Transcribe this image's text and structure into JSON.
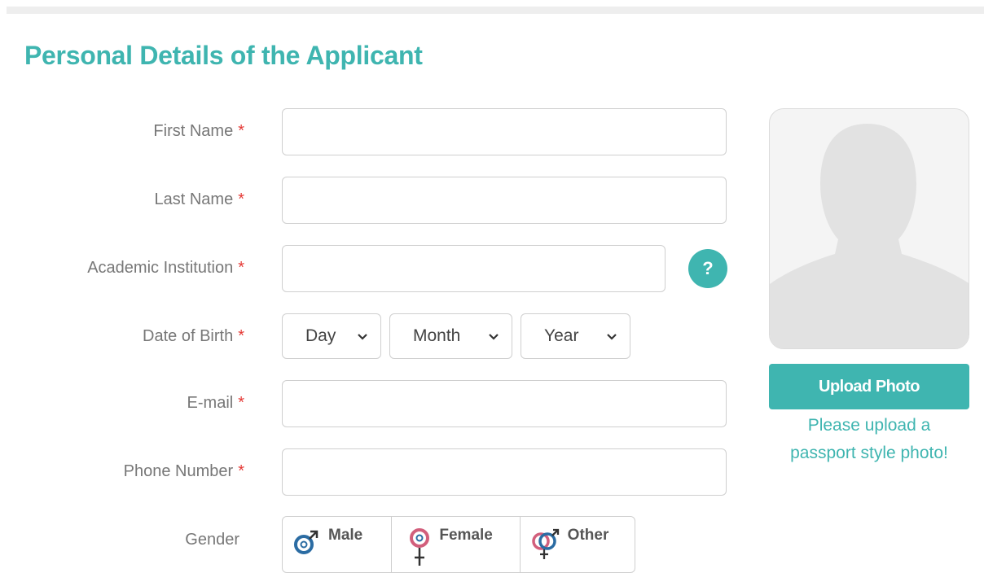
{
  "form": {
    "title": "Personal Details of the Applicant",
    "required_marker": "*",
    "fields": {
      "first_name": {
        "label": "First Name",
        "value": ""
      },
      "last_name": {
        "label": "Last Name",
        "value": ""
      },
      "institution": {
        "label": "Academic Institution",
        "value": "",
        "help": "?"
      },
      "dob": {
        "label": "Date of Birth",
        "day": "Day",
        "month": "Month",
        "year": "Year"
      },
      "email": {
        "label": "E-mail",
        "value": ""
      },
      "phone": {
        "label": "Phone Number",
        "value": ""
      },
      "gender": {
        "label": "Gender",
        "options": [
          "Male",
          "Female",
          "Other"
        ]
      }
    }
  },
  "photo": {
    "upload_label": "Upload Photo",
    "note_line1": "Please upload a",
    "note_line2": "passport style photo!"
  },
  "colors": {
    "accent": "#3fb5b0",
    "required": "#e53935",
    "male": "#2b6ca3",
    "female": "#d25f7c"
  },
  "icons": [
    "help-icon",
    "avatar-placeholder",
    "chevron-down-icon",
    "male-icon",
    "female-icon",
    "other-gender-icon"
  ]
}
